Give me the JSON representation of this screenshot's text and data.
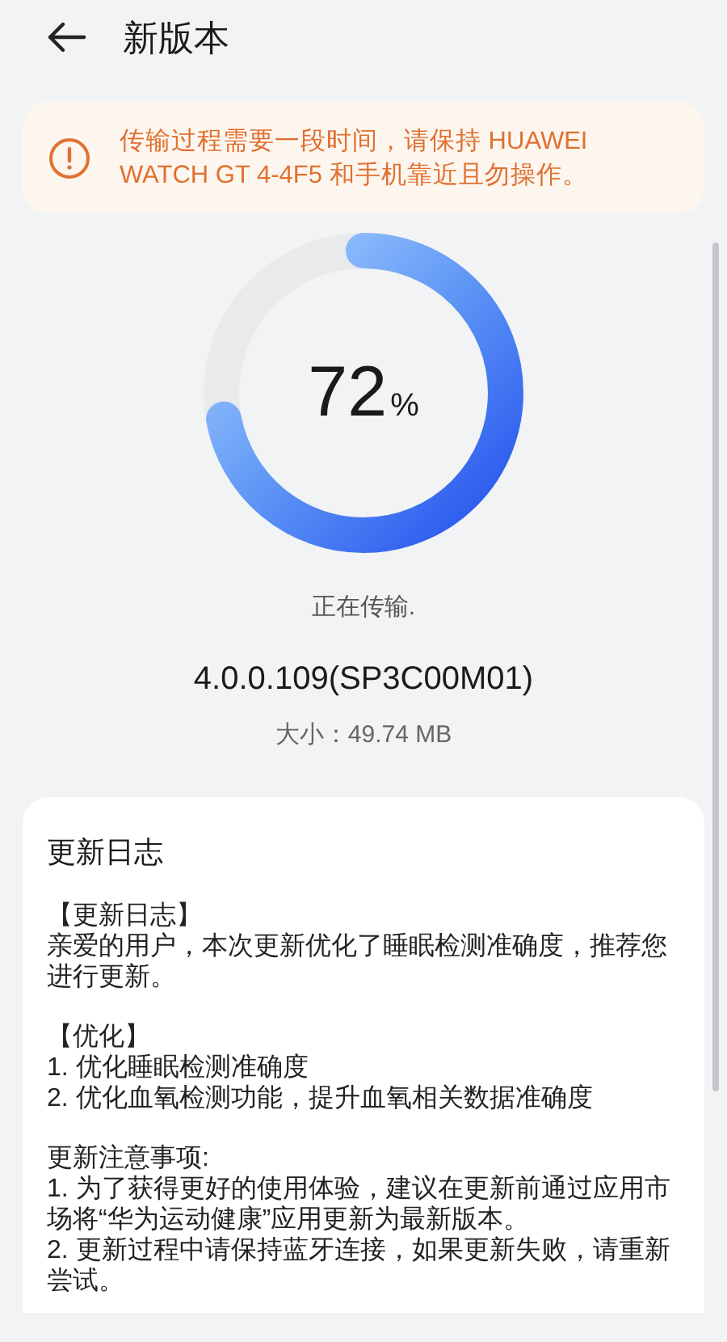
{
  "header": {
    "title": "新版本"
  },
  "notice": {
    "text": "传输过程需要一段时间，请保持 HUAWEI WATCH GT 4-4F5 和手机靠近且勿操作。"
  },
  "progress": {
    "level": 0.72,
    "value": "72",
    "unit": "%",
    "status": "正在传输."
  },
  "version": "4.0.0.109(SP3C00M01)",
  "size": "大小：49.74 MB",
  "changelog": {
    "title": "更新日志",
    "groups": [
      {
        "lines": [
          "【更新日志】",
          "亲爱的用户，本次更新优化了睡眠检测准确度，推荐您进行更新。"
        ]
      },
      {
        "lines": [
          "【优化】",
          "1. 优化睡眠检测准确度",
          "2. 优化血氧检测功能，提升血氧相关数据准确度"
        ]
      },
      {
        "lines": [
          "更新注意事项:",
          "1. 为了获得更好的使用体验，建议在更新前通过应用市场将“华为运动健康”应用更新为最新版本。",
          "2. 更新过程中请保持蓝牙连接，如果更新失败，请重新尝试。"
        ]
      }
    ]
  }
}
